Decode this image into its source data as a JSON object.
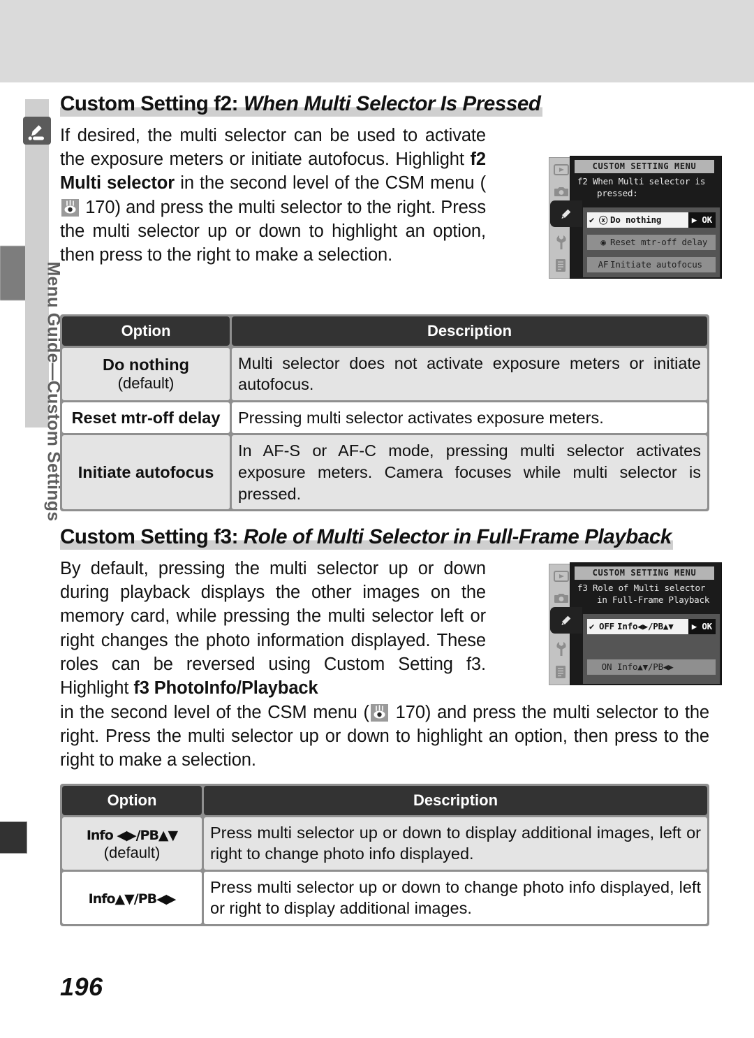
{
  "sidebar": {
    "label": "Menu Guide—Custom Settings",
    "icon": "pencil-tab-icon"
  },
  "page": {
    "number": "196"
  },
  "sections": [
    {
      "heading_prefix": "Custom Setting f2:",
      "heading_italic": "When Multi Selector Is Pressed",
      "body_lead": "If desired, the multi selector can be used to activate the exposure meters or initiate autofocus. Highlight ",
      "body_bold_1": "f2 Multi selector",
      "body_mid": " in the second level of the CSM menu (",
      "page_ref": " 170) and press the multi selector to the right.  Press the multi selector up or down to highlight an option, then press to the right to make a selection.",
      "lcd": {
        "title": "CUSTOM SETTING MENU",
        "prompt_line1": "f2  When Multi selector is",
        "prompt_line2": "pressed:",
        "rows": [
          {
            "check": "✔",
            "glyph": "ⓧ",
            "label": "Do nothing",
            "ok": "▶ OK",
            "state": "selected"
          },
          {
            "check": "",
            "glyph": "◉",
            "label": "Reset mtr-off delay",
            "ok": "",
            "state": "unselected"
          },
          {
            "check": "",
            "glyph": "AF",
            "label": "Initiate autofocus",
            "ok": "",
            "state": "unselected"
          }
        ],
        "rail_icons": [
          "playback-icon",
          "camera-icon",
          "pencil-icon",
          "wrench-icon",
          "list-icon"
        ]
      },
      "table": {
        "headers": [
          "Option",
          "Description"
        ],
        "rows": [
          {
            "option": "Do nothing",
            "option_note": "(default)",
            "description": "Multi selector does not activate exposure meters or initiate autofocus.",
            "shade": "gray"
          },
          {
            "option": "Reset mtr-off delay",
            "option_note": "",
            "description": "Pressing multi selector activates exposure meters.",
            "shade": "white"
          },
          {
            "option": "Initiate autofocus",
            "option_note": "",
            "description": "In AF-S or AF-C mode, pressing multi selector activates exposure meters.  Camera focuses while multi selector is pressed.",
            "shade": "gray"
          }
        ]
      }
    },
    {
      "heading_prefix": "Custom Setting f3:",
      "heading_italic": "Role of Multi Selector in Full-Frame Playback",
      "body_lead": "By default, pressing the multi selector up or down during playback displays the other images on the memory card, while pressing the multi selector left or right changes the photo information displayed.  These roles can be reversed using Custom Setting f3.  Highlight ",
      "body_bold_1": "f3 PhotoInfo/Playback",
      "body_mid": " in the second level of the CSM menu (",
      "page_ref": " 170) and press the multi selector to the right.  Press the multi selector up or down to highlight an option, then press to the right to make a selection.",
      "lcd": {
        "title": "CUSTOM SETTING MENU",
        "prompt_line1": "f3  Role of Multi selector",
        "prompt_line2": "in Full-Frame Playback",
        "rows": [
          {
            "check": "✔",
            "glyph": "OFF",
            "label": "Info◀▶/PB▲▼",
            "ok": "▶ OK",
            "state": "selected"
          },
          {
            "check": "",
            "glyph": "ON",
            "label": "Info▲▼/PB◀▶",
            "ok": "",
            "state": "unselected"
          }
        ],
        "rail_icons": [
          "playback-icon",
          "camera-icon",
          "pencil-icon",
          "wrench-icon",
          "list-icon"
        ]
      },
      "table": {
        "headers": [
          "Option",
          "Description"
        ],
        "rows": [
          {
            "option": "Info ◀▶/PB▲▼",
            "option_note": "(default)",
            "description": "Press multi selector up or down to display additional images, left or right to change photo info displayed.",
            "shade": "gray"
          },
          {
            "option": "Info▲▼/PB◀▶",
            "option_note": "",
            "description": "Press multi selector up or down to change photo info displayed, left or right to display additional images.",
            "shade": "white"
          }
        ]
      }
    }
  ],
  "colors": {
    "table_header_bg": "#333333",
    "table_row_gray": "#e4e4e4",
    "table_row_white": "#ffffff",
    "table_border": "#8f8f8f",
    "heading_band": "#cfcfcf",
    "side_tab_bg": "#cfcfcf",
    "side_tab_text": "#5e5e5e",
    "lcd_bg": "#1b1b1b",
    "lcd_title_bg": "#b4b4b4"
  }
}
